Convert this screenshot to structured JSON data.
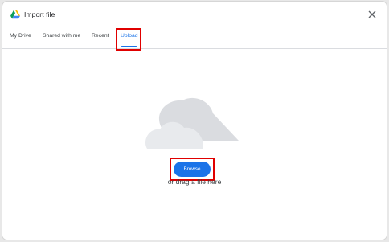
{
  "dialog": {
    "title": "Import file",
    "logo_icon": "google-drive-icon",
    "close_icon": "close-icon"
  },
  "tabs": [
    {
      "label": "My Drive",
      "active": false
    },
    {
      "label": "Shared with me",
      "active": false
    },
    {
      "label": "Recent",
      "active": false
    },
    {
      "label": "Upload",
      "active": true
    }
  ],
  "upload": {
    "illustration_icon": "cloud-icon",
    "browse_label": "Browse",
    "drag_text": "or drag a file here"
  },
  "colors": {
    "accent": "#1a73e8",
    "highlight": "#e00000",
    "cloud_dark": "#dadce0",
    "cloud_light": "#e8eaed"
  }
}
